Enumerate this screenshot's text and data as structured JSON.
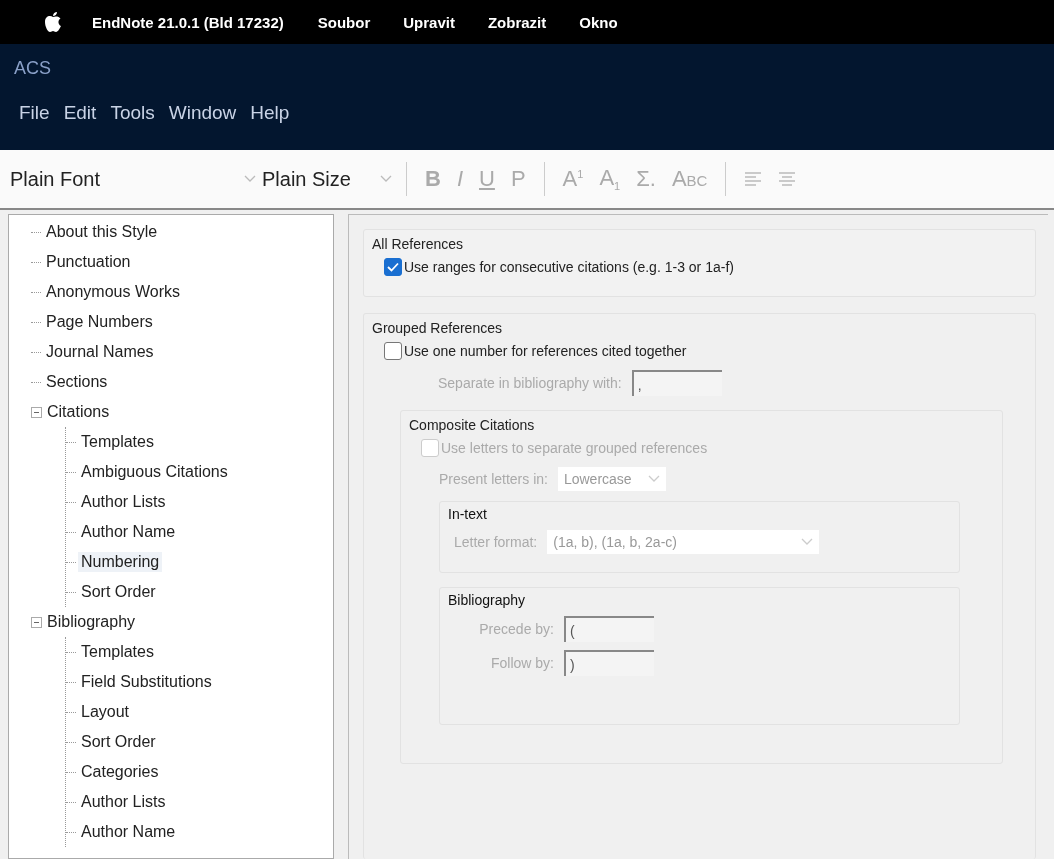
{
  "menubar": {
    "app": "EndNote 21.0.1 (Bld 17232)",
    "items": [
      "Soubor",
      "Upravit",
      "Zobrazit",
      "Okno"
    ]
  },
  "window": {
    "title": "ACS",
    "menu": [
      "File",
      "Edit",
      "Tools",
      "Window",
      "Help"
    ]
  },
  "toolbar": {
    "font": {
      "value": "Plain Font"
    },
    "size": {
      "value": "Plain Size"
    },
    "buttons": [
      {
        "label": "B",
        "kind": "bold",
        "disabled": true
      },
      {
        "label": "I",
        "kind": "italic",
        "disabled": true
      },
      {
        "label": "U",
        "kind": "underline",
        "disabled": true
      },
      {
        "label": "P",
        "kind": "plain",
        "disabled": true
      },
      {
        "label": "A$^{1}$",
        "kind": "superscript",
        "disabled": true
      },
      {
        "label": "A$_{1}$",
        "kind": "subscript",
        "disabled": true
      },
      {
        "label": "Σ.",
        "kind": "symbol",
        "disabled": true
      },
      {
        "label": "Abc",
        "kind": "smallcaps",
        "disabled": true
      }
    ]
  },
  "sidebar": {
    "items": [
      {
        "label": "About this Style",
        "selected": false
      },
      {
        "label": "Punctuation",
        "selected": false
      },
      {
        "label": "Anonymous Works",
        "selected": false
      },
      {
        "label": "Page Numbers",
        "selected": false
      },
      {
        "label": "Journal Names",
        "selected": false
      },
      {
        "label": "Sections",
        "selected": false
      },
      {
        "label": "Citations",
        "selected": false,
        "expanded": true,
        "children": [
          {
            "label": "Templates",
            "selected": false
          },
          {
            "label": "Ambiguous Citations",
            "selected": false
          },
          {
            "label": "Author Lists",
            "selected": false
          },
          {
            "label": "Author Name",
            "selected": false
          },
          {
            "label": "Numbering",
            "selected": true
          },
          {
            "label": "Sort Order",
            "selected": false
          }
        ]
      },
      {
        "label": "Bibliography",
        "selected": false,
        "expanded": true,
        "children": [
          {
            "label": "Templates",
            "selected": false
          },
          {
            "label": "Field Substitutions",
            "selected": false
          },
          {
            "label": "Layout",
            "selected": false
          },
          {
            "label": "Sort Order",
            "selected": false
          },
          {
            "label": "Categories",
            "selected": false
          },
          {
            "label": "Author Lists",
            "selected": false
          },
          {
            "label": "Author Name",
            "selected": false
          }
        ]
      }
    ]
  },
  "all_references": {
    "title": "All References",
    "option": {
      "label": "Use ranges for consecutive citations (e.g. 1-3 or 1a-f)",
      "checked": true,
      "disabled": false
    }
  },
  "grouped_references": {
    "title": "Grouped References",
    "option": {
      "label": "Use one number for references cited together",
      "checked": false,
      "disabled": false
    },
    "separator": {
      "label": "Separate in bibliography with:",
      "value": ",",
      "disabled": true
    },
    "composite": {
      "title": "Composite Citations",
      "option": {
        "label": "Use letters to separate grouped references",
        "checked": false,
        "disabled": true
      },
      "present": {
        "label": "Present letters in:",
        "value": "Lowercase",
        "disabled": true
      },
      "in_text": {
        "title": "In-text",
        "letter_format": {
          "label": "Letter format:",
          "value": "(1a, b), (1a, b, 2a-c)",
          "disabled": true
        }
      },
      "bibliography": {
        "title": "Bibliography",
        "fields": [
          {
            "label": "Precede by:",
            "value": "(",
            "disabled": true
          },
          {
            "label": "Follow by:",
            "value": ")",
            "disabled": true
          }
        ]
      }
    }
  }
}
